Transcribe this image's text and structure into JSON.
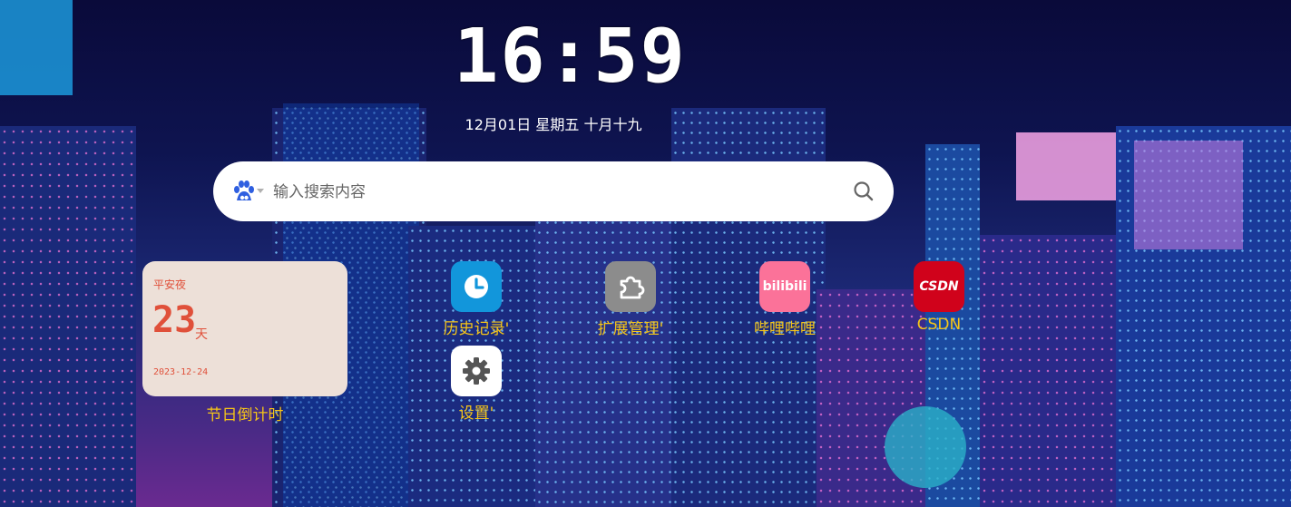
{
  "clock": {
    "time": "16:59",
    "date": "12月01日 星期五 十月十九"
  },
  "search": {
    "placeholder": "输入搜索内容",
    "engine_icon": "baidu-icon",
    "search_icon": "search-icon"
  },
  "widget": {
    "title": "平安夜",
    "days": "23",
    "unit": "天",
    "date": "2023-12-24",
    "label": "节日倒计时"
  },
  "apps": [
    {
      "label": "历史记录'",
      "icon": "clock-icon",
      "color": "#1296db"
    },
    {
      "label": "扩展管理'",
      "icon": "puzzle-icon",
      "color": "#8c8c8c"
    },
    {
      "label": "哔哩哔哩",
      "icon": "bilibili-icon",
      "color": "#fb7299",
      "icon_text": "bilibili"
    },
    {
      "label": "CSDN",
      "icon": "csdn-icon",
      "color": "#d0021b",
      "icon_text": "CSDN"
    },
    {
      "label": "设置'",
      "icon": "gear-icon",
      "color": "#ffffff"
    }
  ]
}
